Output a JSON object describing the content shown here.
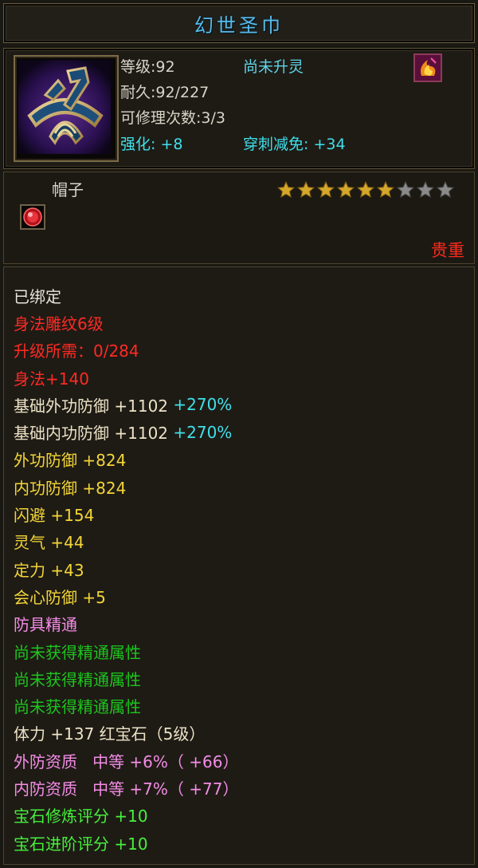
{
  "title": "幻世圣巾",
  "header": {
    "level_label": "等级",
    "level_value": ":92",
    "soul_status": "尚未升灵",
    "durability_label": "耐久",
    "durability_value": ":92/227",
    "repair_label": "可修理次数",
    "repair_value": ":3/3",
    "enhance": "强化: +8",
    "pierce": "穿刺减免: +34",
    "item_icon": "headband-icon",
    "soul_icon": "soul-flame-icon"
  },
  "sub": {
    "type": "帽子",
    "stars_filled": 6,
    "stars_total": 9,
    "gem_slot_icon": "red-gem-icon",
    "rarity": "贵重"
  },
  "attrs": [
    {
      "parts": [
        {
          "t": "已绑定",
          "c": "white"
        }
      ]
    },
    {
      "parts": [
        {
          "t": "身法雕纹6级",
          "c": "red"
        }
      ]
    },
    {
      "parts": [
        {
          "t": "升级所需：0/284",
          "c": "red"
        }
      ]
    },
    {
      "parts": [
        {
          "t": "身法+140",
          "c": "red"
        }
      ]
    },
    {
      "parts": [
        {
          "t": "基础外功防御 +1102 ",
          "c": "beige"
        },
        {
          "t": "+270%",
          "c": "cyan"
        }
      ]
    },
    {
      "parts": [
        {
          "t": "基础内功防御 +1102 ",
          "c": "beige"
        },
        {
          "t": "+270%",
          "c": "cyan"
        }
      ]
    },
    {
      "parts": [
        {
          "t": "外功防御 +824",
          "c": "yellow"
        }
      ]
    },
    {
      "parts": [
        {
          "t": "内功防御 +824",
          "c": "yellow"
        }
      ]
    },
    {
      "parts": [
        {
          "t": "闪避 +154",
          "c": "yellow"
        }
      ]
    },
    {
      "parts": [
        {
          "t": "灵气 +44",
          "c": "yellow"
        }
      ]
    },
    {
      "parts": [
        {
          "t": "定力 +43",
          "c": "yellow"
        }
      ]
    },
    {
      "parts": [
        {
          "t": "会心防御 +5",
          "c": "yellow"
        }
      ]
    },
    {
      "parts": [
        {
          "t": "防具精通",
          "c": "pink"
        }
      ]
    },
    {
      "parts": [
        {
          "t": "尚未获得精通属性",
          "c": "green"
        }
      ]
    },
    {
      "parts": [
        {
          "t": "尚未获得精通属性",
          "c": "green"
        }
      ]
    },
    {
      "parts": [
        {
          "t": "尚未获得精通属性",
          "c": "green"
        }
      ]
    },
    {
      "parts": [
        {
          "t": "体力 +137 红宝石（5级）",
          "c": "beige"
        }
      ]
    },
    {
      "parts": [
        {
          "t": "外防资质   中等 +6%（ +66）",
          "c": "pink"
        }
      ]
    },
    {
      "parts": [
        {
          "t": "内防资质   中等 +7%（ +77）",
          "c": "pink"
        }
      ]
    },
    {
      "parts": [
        {
          "t": "宝石修炼评分 +10",
          "c": "bgreen"
        }
      ]
    },
    {
      "parts": [
        {
          "t": "宝石进阶评分 +10",
          "c": "bgreen"
        }
      ]
    }
  ],
  "colors": {
    "white": "#e8e4d8",
    "red": "#ff2a24",
    "beige": "#ece2c6",
    "yellow": "#f3d538",
    "pink": "#f48ce6",
    "green": "#1ec41e",
    "bgreen": "#46f03c",
    "cyan": "#3fe0ea",
    "star_on": "#d4a62a",
    "star_off": "#8a8a8a"
  }
}
